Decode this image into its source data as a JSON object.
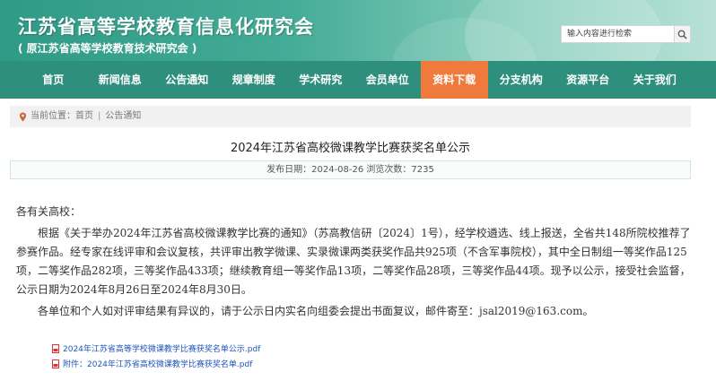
{
  "header": {
    "title": "江苏省高等学校教育信息化研究会",
    "subtitle": "( 原江苏省高等学校教育技术研究会 )",
    "search_placeholder": "输入内容进行检索"
  },
  "nav": {
    "items": [
      {
        "label": "首页"
      },
      {
        "label": "新闻信息"
      },
      {
        "label": "公告通知"
      },
      {
        "label": "规章制度"
      },
      {
        "label": "学术研究"
      },
      {
        "label": "会员单位"
      },
      {
        "label": "资料下载"
      },
      {
        "label": "分支机构"
      },
      {
        "label": "资源平台"
      },
      {
        "label": "关于我们"
      }
    ],
    "active_label": "资料下载",
    "active_color": "#f07a3c",
    "bar_color": "#2e8f7c"
  },
  "breadcrumb": {
    "prefix": "当前位置：首页",
    "separator": "|",
    "current": "公告通知"
  },
  "article": {
    "title": "2024年江苏省高校微课教学比赛获奖名单公示",
    "meta": "发布日期：2024-08-26  浏览次数：7235",
    "salutation": "各有关高校：",
    "paragraph1": "根据《关于举办2024年江苏省高校微课教学比赛的通知》（苏高教信研〔2024〕1号），经学校遴选、线上报送，全省共148所院校推荐了参赛作品。经专家在线评审和会议复核，共评审出教学微课、实录微课两类获奖作品共925项（不含军事院校），其中全日制组一等奖作品125项，二等奖作品282项，三等奖作品433项；继续教育组一等奖作品13项，二等奖作品28项，三等奖作品44项。现予以公示，接受社会监督，公示日期为2024年8月26日至2024年8月30日。",
    "paragraph2": "各单位和个人如对评审结果有异议的，请于公示日内实名向组委会提出书面复议，邮件寄至：jsal2019@163.com。",
    "attachments": [
      {
        "label": "2024年江苏省高等学校微课教学比赛获奖名单公示.pdf"
      },
      {
        "label": "附件：2024年江苏省高校微课教学比赛获奖名单.pdf"
      }
    ]
  }
}
